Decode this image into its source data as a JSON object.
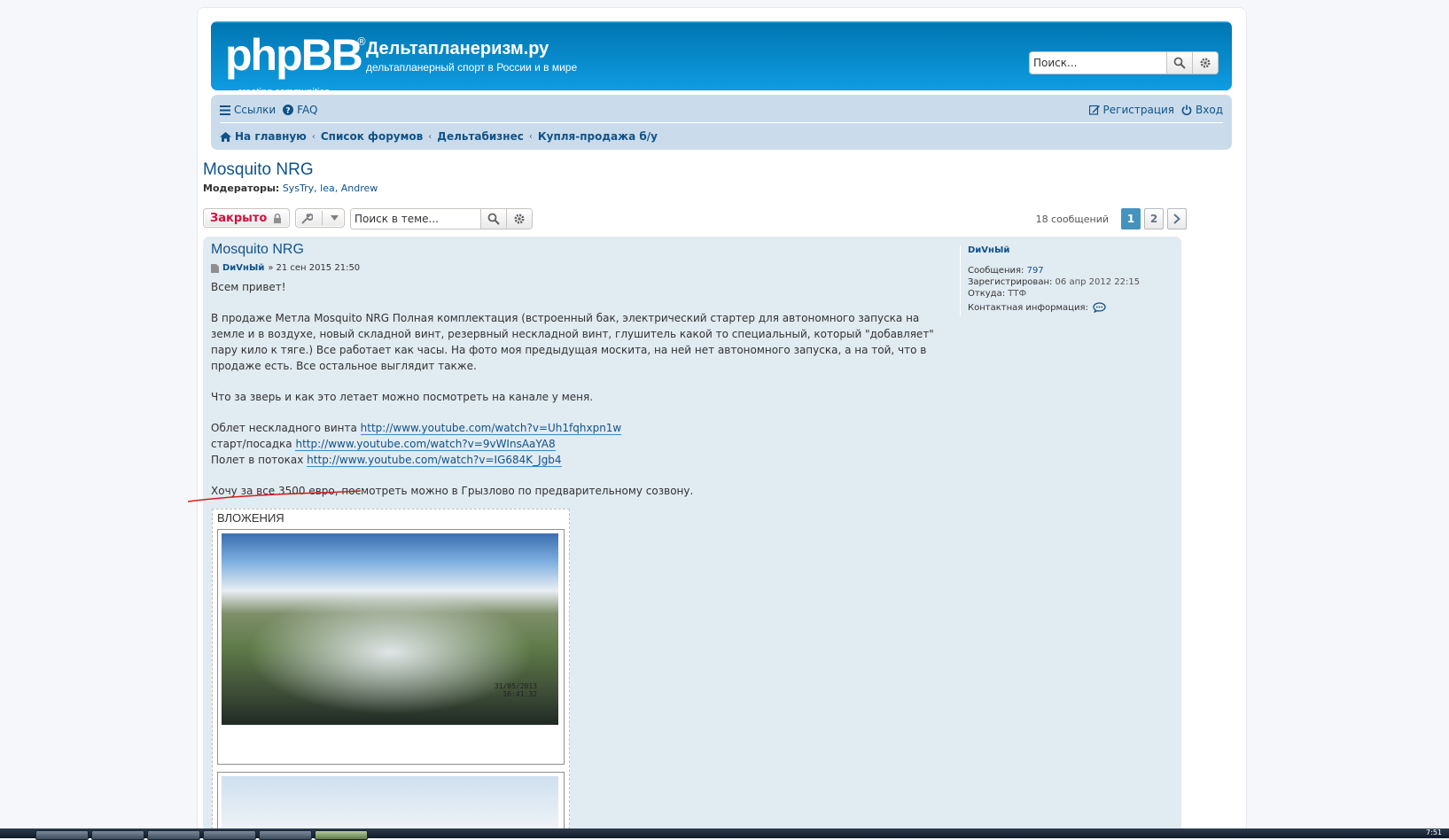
{
  "header": {
    "logo_main": "phpBB",
    "logo_reg": "®",
    "logo_sub": "creating    communities",
    "site_title": "Дельтапланеризм.ру",
    "site_desc": "дельтапланерный спорт в России и в мире",
    "search_placeholder": "Поиск..."
  },
  "nav": {
    "links": "Ссылки",
    "faq": "FAQ",
    "register": "Регистрация",
    "login": "Вход",
    "breadcrumbs": [
      "На главную",
      "Список форумов",
      "Дельтабизнес",
      "Купля-продажа б/у"
    ]
  },
  "topic": {
    "title": "Mosquito NRG",
    "moderators_label": "Модераторы:",
    "moderators": "SysTry, lea, Andrew"
  },
  "actions": {
    "locked_label": "Закрыто",
    "topic_search_placeholder": "Поиск в теме...",
    "message_count": "18 сообщений",
    "pages": [
      "1",
      "2"
    ],
    "current_page": "1"
  },
  "post": {
    "title": "Mosquito NRG",
    "author": "DиVнЫй",
    "date_prefix": "»",
    "date": "21 сен 2015 21:50",
    "greeting": "Всем привет!",
    "paragraph1": "В продаже Метла Mosquito NRG Полная комплектация (встроенный бак, электрический стартер для автономного запуска на земле и в воздухе, новый складной винт, резервный нескладной винт, глушитель какой то специальный, который \"добавляет\" пару кило к тяге.) Все работает как часы. На фото моя предыдущая москита, на ней нет автономного запуска, а на той, что в продаже есть. Все остальное выглядит также.",
    "paragraph2": "Что за зверь и как это летает можно посмотреть на канале у меня.",
    "links": [
      {
        "label": "Облет нескладного винта",
        "url": "http://www.youtube.com/watch?v=Uh1fqhxpn1w"
      },
      {
        "label": "старт/посадка",
        "url": "http://www.youtube.com/watch?v=9vWInsAaYA8"
      },
      {
        "label": "Полет в потоках",
        "url": "http://www.youtube.com/watch?v=IG684K_Jgb4"
      }
    ],
    "price_line": "Хочу за все 3500 евро, посмотреть можно в Грызлово по предварительному созвону.",
    "attachments_label": "ВЛОЖЕНИЯ",
    "photo_stamp": "31/05/2013\n16:41:32"
  },
  "profile": {
    "username": "DиVнЫй",
    "posts_label": "Сообщения:",
    "posts": "797",
    "registered_label": "Зарегистрирован:",
    "registered": "06 апр 2012 22:15",
    "from_label": "Откуда:",
    "from": "ТТФ",
    "contact_label": "Контактная информация:"
  },
  "taskbar": {
    "time": "7:51"
  },
  "colors": {
    "header_blue": "#12a3eb",
    "nav_bg": "#cadceb",
    "post_bg": "#e1ebf2",
    "link": "#105289",
    "locked_red": "#d31141",
    "page_active": "#4692bf"
  }
}
